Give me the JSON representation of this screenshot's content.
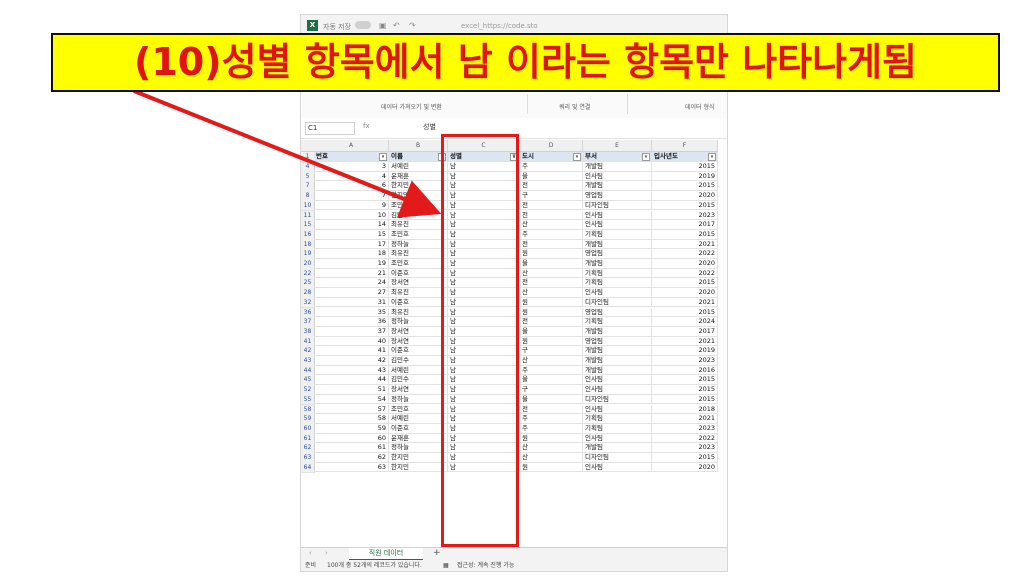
{
  "banner": {
    "text": "(10)성별 항목에서 남 이라는 항목만 나타나게됨"
  },
  "titlebar": {
    "autosave_label": "자동 저장",
    "file_name": "excel_https://code.sto"
  },
  "ribbon": {
    "groups": [
      "데이터 가져오기 및 변환",
      "쿼리 및 연결",
      "데이터 형식"
    ]
  },
  "formula_bar": {
    "name_box": "C1",
    "fx": "fx",
    "value": "성별"
  },
  "columns": [
    "A",
    "B",
    "C",
    "D",
    "E",
    "F"
  ],
  "table": {
    "headers": [
      "번호",
      "이름",
      "성별",
      "도시",
      "부서",
      "입사년도"
    ],
    "rows": [
      {
        "rn": "4",
        "no": "3",
        "name": "서예린",
        "gender": "남",
        "city": "주",
        "dept": "개발팀",
        "year": "2015"
      },
      {
        "rn": "5",
        "no": "4",
        "name": "윤재훈",
        "gender": "남",
        "city": "울",
        "dept": "인사팀",
        "year": "2019"
      },
      {
        "rn": "7",
        "no": "6",
        "name": "한지민",
        "gender": "남",
        "city": "전",
        "dept": "개발팀",
        "year": "2015"
      },
      {
        "rn": "8",
        "no": "7",
        "name": "한지민",
        "gender": "남",
        "city": "구",
        "dept": "영업팀",
        "year": "2020"
      },
      {
        "rn": "10",
        "no": "9",
        "name": "조민호",
        "gender": "남",
        "city": "전",
        "dept": "디자인팀",
        "year": "2015"
      },
      {
        "rn": "11",
        "no": "10",
        "name": "김민수",
        "gender": "남",
        "city": "천",
        "dept": "인사팀",
        "year": "2023"
      },
      {
        "rn": "15",
        "no": "14",
        "name": "최유진",
        "gender": "남",
        "city": "산",
        "dept": "인사팀",
        "year": "2017"
      },
      {
        "rn": "16",
        "no": "15",
        "name": "조민호",
        "gender": "남",
        "city": "주",
        "dept": "기획팀",
        "year": "2015"
      },
      {
        "rn": "18",
        "no": "17",
        "name": "정하늘",
        "gender": "남",
        "city": "전",
        "dept": "개발팀",
        "year": "2021"
      },
      {
        "rn": "19",
        "no": "18",
        "name": "최유진",
        "gender": "남",
        "city": "원",
        "dept": "영업팀",
        "year": "2022"
      },
      {
        "rn": "20",
        "no": "19",
        "name": "조민호",
        "gender": "남",
        "city": "울",
        "dept": "개발팀",
        "year": "2020"
      },
      {
        "rn": "22",
        "no": "21",
        "name": "이준호",
        "gender": "남",
        "city": "산",
        "dept": "기획팀",
        "year": "2022"
      },
      {
        "rn": "25",
        "no": "24",
        "name": "장서연",
        "gender": "남",
        "city": "전",
        "dept": "기획팀",
        "year": "2015"
      },
      {
        "rn": "28",
        "no": "27",
        "name": "최유진",
        "gender": "남",
        "city": "산",
        "dept": "인사팀",
        "year": "2020"
      },
      {
        "rn": "32",
        "no": "31",
        "name": "이준호",
        "gender": "남",
        "city": "원",
        "dept": "디자인팀",
        "year": "2021"
      },
      {
        "rn": "36",
        "no": "35",
        "name": "최유진",
        "gender": "남",
        "city": "원",
        "dept": "영업팀",
        "year": "2015"
      },
      {
        "rn": "37",
        "no": "36",
        "name": "정하늘",
        "gender": "남",
        "city": "전",
        "dept": "기획팀",
        "year": "2024"
      },
      {
        "rn": "38",
        "no": "37",
        "name": "장서연",
        "gender": "남",
        "city": "울",
        "dept": "개발팀",
        "year": "2017"
      },
      {
        "rn": "41",
        "no": "40",
        "name": "장서연",
        "gender": "남",
        "city": "원",
        "dept": "영업팀",
        "year": "2021"
      },
      {
        "rn": "42",
        "no": "41",
        "name": "이준호",
        "gender": "남",
        "city": "구",
        "dept": "개발팀",
        "year": "2019"
      },
      {
        "rn": "43",
        "no": "42",
        "name": "김민수",
        "gender": "남",
        "city": "산",
        "dept": "개발팀",
        "year": "2023"
      },
      {
        "rn": "44",
        "no": "43",
        "name": "서예린",
        "gender": "남",
        "city": "주",
        "dept": "개발팀",
        "year": "2016"
      },
      {
        "rn": "45",
        "no": "44",
        "name": "김민수",
        "gender": "남",
        "city": "울",
        "dept": "인사팀",
        "year": "2015"
      },
      {
        "rn": "52",
        "no": "51",
        "name": "장서연",
        "gender": "남",
        "city": "구",
        "dept": "인사팀",
        "year": "2015"
      },
      {
        "rn": "55",
        "no": "54",
        "name": "정하늘",
        "gender": "남",
        "city": "울",
        "dept": "디자인팀",
        "year": "2015"
      },
      {
        "rn": "58",
        "no": "57",
        "name": "조민호",
        "gender": "남",
        "city": "전",
        "dept": "인사팀",
        "year": "2018"
      },
      {
        "rn": "59",
        "no": "58",
        "name": "서예린",
        "gender": "남",
        "city": "주",
        "dept": "기획팀",
        "year": "2021"
      },
      {
        "rn": "60",
        "no": "59",
        "name": "이준호",
        "gender": "남",
        "city": "주",
        "dept": "기획팀",
        "year": "2023"
      },
      {
        "rn": "61",
        "no": "60",
        "name": "윤재훈",
        "gender": "남",
        "city": "원",
        "dept": "인사팀",
        "year": "2022"
      },
      {
        "rn": "62",
        "no": "61",
        "name": "정하늘",
        "gender": "남",
        "city": "산",
        "dept": "개발팀",
        "year": "2023"
      },
      {
        "rn": "63",
        "no": "62",
        "name": "한지민",
        "gender": "남",
        "city": "산",
        "dept": "디자인팀",
        "year": "2015"
      },
      {
        "rn": "64",
        "no": "63",
        "name": "한지민",
        "gender": "남",
        "city": "원",
        "dept": "인사팀",
        "year": "2020"
      }
    ]
  },
  "sheet_tab": {
    "name": "직원 데이터",
    "add": "+"
  },
  "status_bar": {
    "ready": "준비",
    "records": "100개 중 52개의 레코드가 있습니다.",
    "accessibility": "접근성: 계속 진행 가능"
  },
  "colors": {
    "banner_bg": "#ffff00",
    "banner_text": "#e01414",
    "highlight": "#e21a1a",
    "excel_green": "#1d6f42"
  }
}
